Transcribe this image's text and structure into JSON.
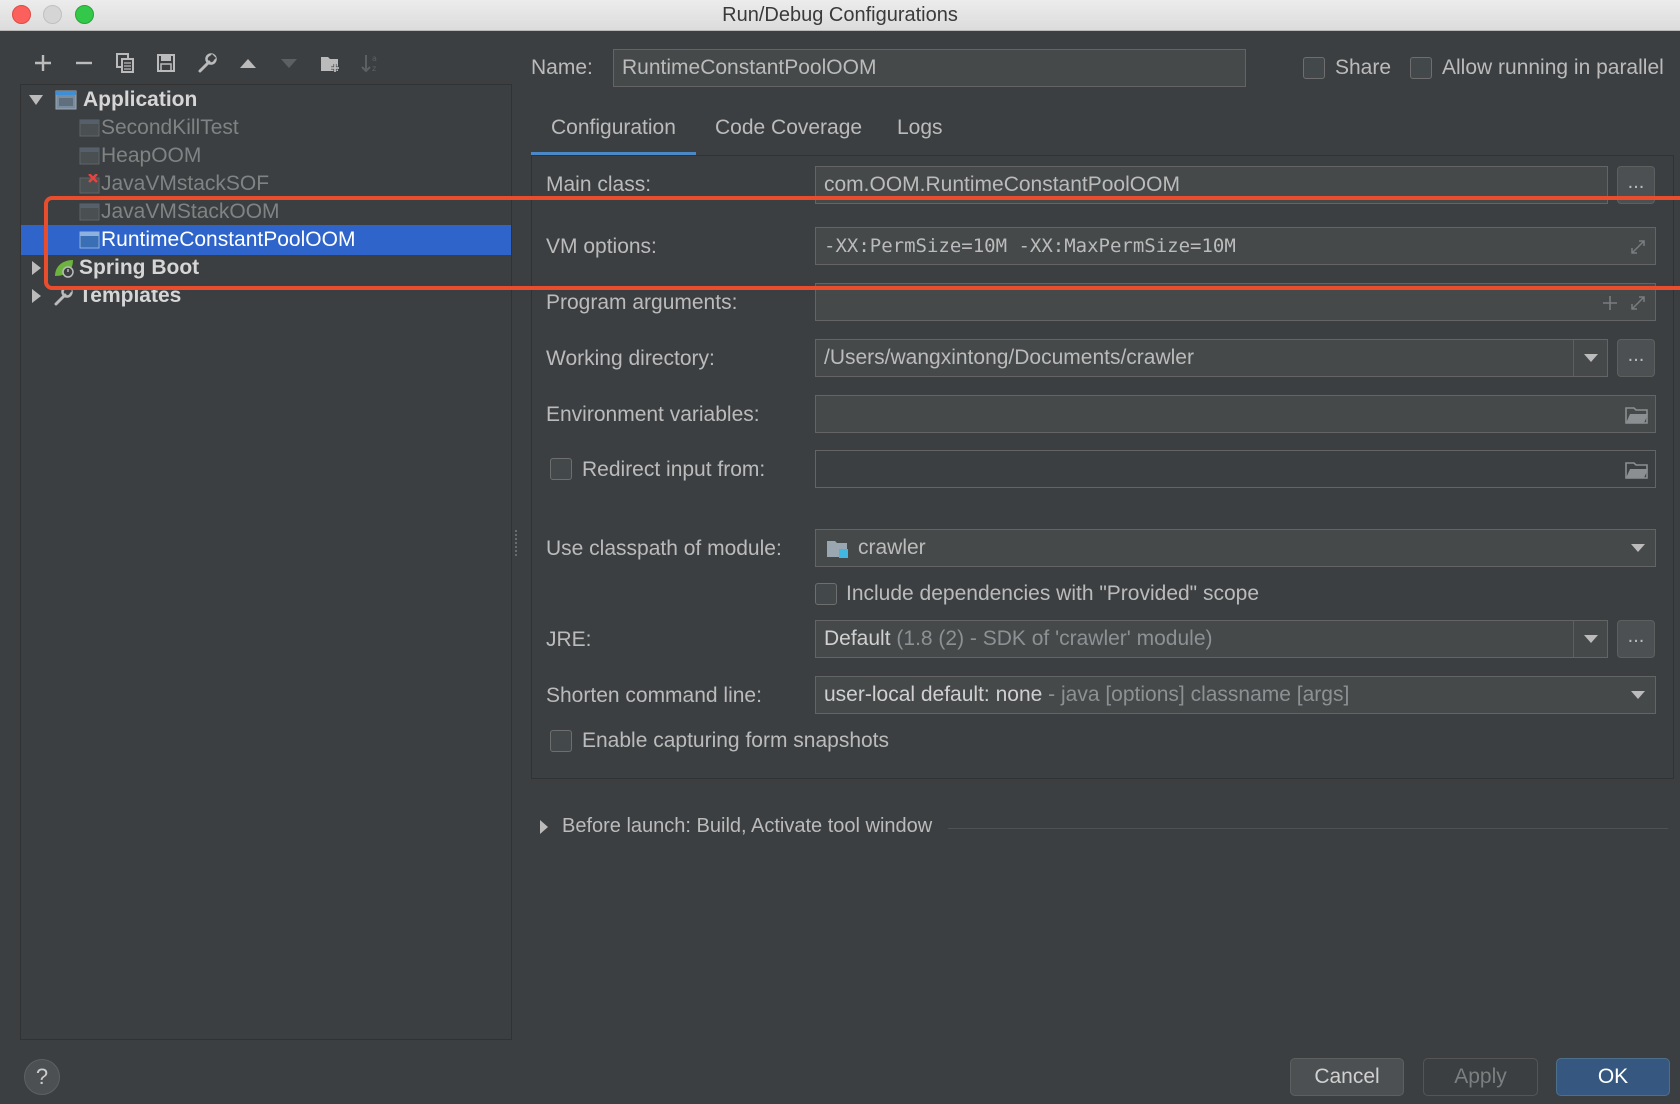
{
  "window": {
    "title": "Run/Debug Configurations"
  },
  "toolbar": {
    "items": [
      "add-icon",
      "remove-icon",
      "copy-icon",
      "save-icon",
      "wrench-icon",
      "arrow-up-icon",
      "arrow-down-icon",
      "folder-add-icon",
      "sort-icon"
    ]
  },
  "tree": {
    "application": {
      "label": "Application"
    },
    "items": [
      {
        "label": "SecondKillTest"
      },
      {
        "label": "HeapOOM"
      },
      {
        "label": "JavaVMstackSOF"
      },
      {
        "label": "JavaVMStackOOM"
      },
      {
        "label": "RuntimeConstantPoolOOM"
      }
    ],
    "spring_boot": {
      "label": "Spring Boot"
    },
    "templates": {
      "label": "Templates"
    }
  },
  "header": {
    "name_label": "Name:",
    "name_value": "RuntimeConstantPoolOOM",
    "share_label": "Share",
    "parallel_label": "Allow running in parallel"
  },
  "tabs": [
    {
      "label": "Configuration"
    },
    {
      "label": "Code Coverage"
    },
    {
      "label": "Logs"
    }
  ],
  "form": {
    "main_class_label": "Main class:",
    "main_class_value": "com.OOM.RuntimeConstantPoolOOM",
    "vm_options_label": "VM options:",
    "vm_options_value": "-XX:PermSize=10M -XX:MaxPermSize=10M",
    "program_args_label": "Program arguments:",
    "program_args_value": "",
    "working_dir_label": "Working directory:",
    "working_dir_value": "/Users/wangxintong/Documents/crawler",
    "env_vars_label": "Environment variables:",
    "env_vars_value": "",
    "redirect_label": "Redirect input from:",
    "redirect_value": "",
    "classpath_label": "Use classpath of module:",
    "classpath_value": "crawler",
    "include_deps_label": "Include dependencies with \"Provided\" scope",
    "jre_label": "JRE:",
    "jre_value_main": "Default",
    "jre_value_detail": "(1.8 (2) - SDK of 'crawler' module)",
    "shorten_label": "Shorten command line:",
    "shorten_value_main": "user-local default: none",
    "shorten_value_detail": "- java [options] classname [args]",
    "snapshots_label": "Enable capturing form snapshots"
  },
  "before_launch": {
    "label": "Before launch: Build, Activate tool window"
  },
  "footer": {
    "help_label": "?",
    "cancel_label": "Cancel",
    "apply_label": "Apply",
    "ok_label": "OK"
  },
  "colors": {
    "background": "#3c3f41",
    "selection": "#2f65ca",
    "highlight_box": "#e84e2d",
    "ok_button": "#365880",
    "tab_underline": "#4a88c7"
  }
}
